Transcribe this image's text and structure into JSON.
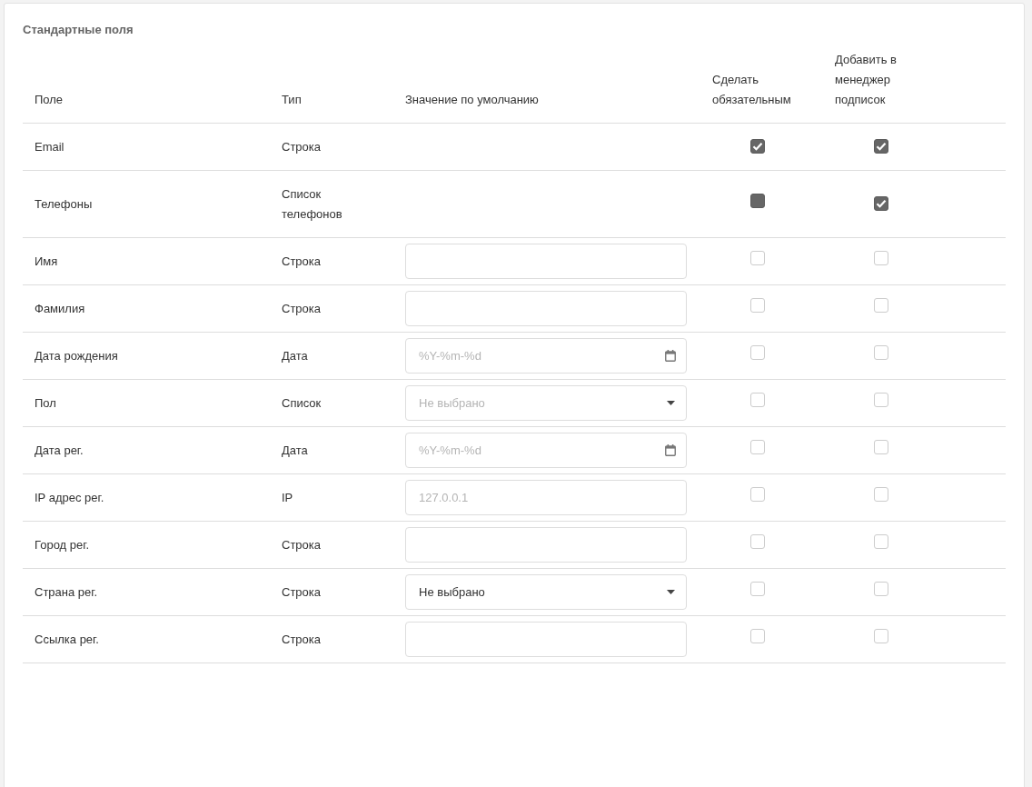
{
  "card": {
    "title": "Стандартные поля"
  },
  "table": {
    "columns": [
      "Поле",
      "Тип",
      "Значение по умолчанию",
      "Сделать обязательным",
      "Добавить в менеджер подписок"
    ],
    "rows": [
      {
        "field": "Email",
        "type": "Строка",
        "default": {
          "kind": "none"
        },
        "required": {
          "kind": "checkbox",
          "checked": true
        },
        "subscription": {
          "kind": "checkbox",
          "checked": true
        }
      },
      {
        "field": "Телефоны",
        "type": "Список телефонов",
        "default": {
          "kind": "none"
        },
        "required": {
          "kind": "locked",
          "checked": true
        },
        "subscription": {
          "kind": "checkbox",
          "checked": true
        }
      },
      {
        "field": "Имя",
        "type": "Строка",
        "default": {
          "kind": "text"
        },
        "required": {
          "kind": "checkbox",
          "checked": false
        },
        "subscription": {
          "kind": "checkbox",
          "checked": false
        }
      },
      {
        "field": "Фамилия",
        "type": "Строка",
        "default": {
          "kind": "text"
        },
        "required": {
          "kind": "checkbox",
          "checked": false
        },
        "subscription": {
          "kind": "checkbox",
          "checked": false
        }
      },
      {
        "field": "Дата рождения",
        "type": "Дата",
        "default": {
          "kind": "date",
          "placeholder": "%Y-%m-%d"
        },
        "required": {
          "kind": "checkbox",
          "checked": false
        },
        "subscription": {
          "kind": "checkbox",
          "checked": false
        }
      },
      {
        "field": "Пол",
        "type": "Список",
        "default": {
          "kind": "select",
          "placeholder": "Не выбрано"
        },
        "required": {
          "kind": "checkbox",
          "checked": false
        },
        "subscription": {
          "kind": "checkbox",
          "checked": false
        }
      },
      {
        "field": "Дата рег.",
        "type": "Дата",
        "default": {
          "kind": "date",
          "placeholder": "%Y-%m-%d"
        },
        "required": {
          "kind": "checkbox",
          "checked": false
        },
        "subscription": {
          "kind": "checkbox",
          "checked": false
        }
      },
      {
        "field": "IP адрес рег.",
        "type": "IP",
        "default": {
          "kind": "text",
          "placeholder": "127.0.0.1"
        },
        "required": {
          "kind": "checkbox",
          "checked": false
        },
        "subscription": {
          "kind": "checkbox",
          "checked": false
        }
      },
      {
        "field": "Город рег.",
        "type": "Строка",
        "default": {
          "kind": "text"
        },
        "required": {
          "kind": "checkbox",
          "checked": false
        },
        "subscription": {
          "kind": "checkbox",
          "checked": false
        }
      },
      {
        "field": "Страна рег.",
        "type": "Строка",
        "default": {
          "kind": "select",
          "value": "Не выбрано"
        },
        "required": {
          "kind": "checkbox",
          "checked": false
        },
        "subscription": {
          "kind": "checkbox",
          "checked": false
        }
      },
      {
        "field": "Ссылка рег.",
        "type": "Строка",
        "default": {
          "kind": "text"
        },
        "required": {
          "kind": "checkbox",
          "checked": false
        },
        "subscription": {
          "kind": "checkbox",
          "checked": false
        }
      }
    ]
  }
}
